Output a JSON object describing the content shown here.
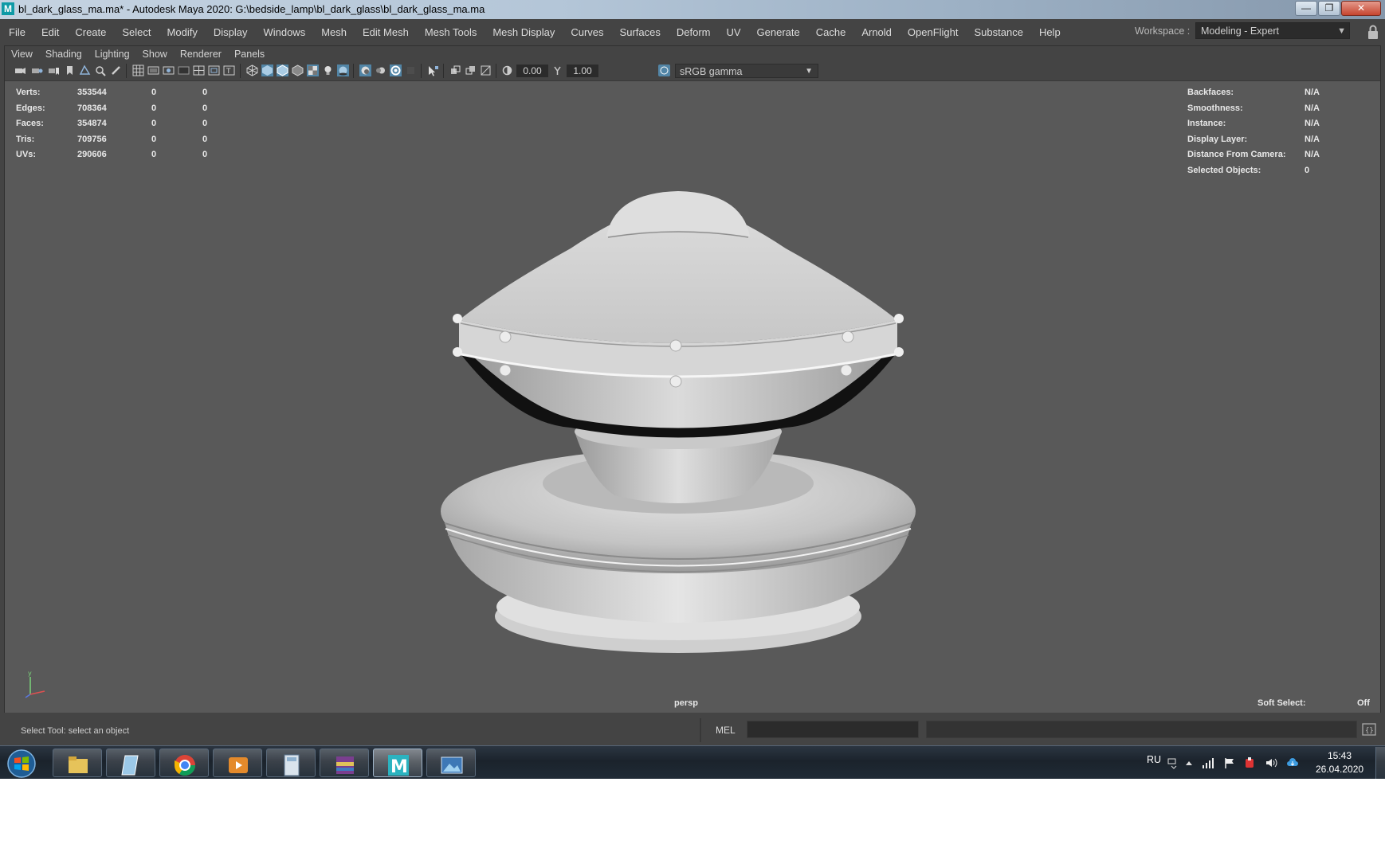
{
  "window": {
    "title": "bl_dark_glass_ma.ma* - Autodesk Maya 2020: G:\\bedside_lamp\\bl_dark_glass\\bl_dark_glass_ma.ma",
    "app_icon": "maya-icon",
    "minimize_glyph": "—",
    "maximize_glyph": "❐",
    "close_glyph": "✕"
  },
  "menubar": {
    "items": [
      "File",
      "Edit",
      "Create",
      "Select",
      "Modify",
      "Display",
      "Windows",
      "Mesh",
      "Edit Mesh",
      "Mesh Tools",
      "Mesh Display",
      "Curves",
      "Surfaces",
      "Deform",
      "UV",
      "Generate",
      "Cache",
      "Arnold",
      "OpenFlight",
      "Substance",
      "Help"
    ],
    "workspace_label": "Workspace :",
    "workspace_value": "Modeling - Expert"
  },
  "panel_menu": {
    "items": [
      "View",
      "Shading",
      "Lighting",
      "Show",
      "Renderer",
      "Panels"
    ]
  },
  "toolbar": {
    "exposure": "0.00",
    "gamma": "1.00",
    "colorspace": "sRGB gamma"
  },
  "hud_left": {
    "rows": [
      {
        "label": "Verts:",
        "total": "353544",
        "sel": "0",
        "comp": "0"
      },
      {
        "label": "Edges:",
        "total": "708364",
        "sel": "0",
        "comp": "0"
      },
      {
        "label": "Faces:",
        "total": "354874",
        "sel": "0",
        "comp": "0"
      },
      {
        "label": "Tris:",
        "total": "709756",
        "sel": "0",
        "comp": "0"
      },
      {
        "label": "UVs:",
        "total": "290606",
        "sel": "0",
        "comp": "0"
      }
    ]
  },
  "hud_right": {
    "rows": [
      {
        "label": "Backfaces:",
        "value": "N/A"
      },
      {
        "label": "Smoothness:",
        "value": "N/A"
      },
      {
        "label": "Instance:",
        "value": "N/A"
      },
      {
        "label": "Display Layer:",
        "value": "N/A"
      },
      {
        "label": "Distance From Camera:",
        "value": "N/A"
      },
      {
        "label": "Selected Objects:",
        "value": "0"
      }
    ]
  },
  "viewport": {
    "camera": "persp",
    "soft_select_label": "Soft Select:",
    "soft_select_value": "Off",
    "axis_y": "y"
  },
  "bottom": {
    "status": "Select Tool: select an object",
    "mel_label": "MEL"
  },
  "taskbar": {
    "apps": [
      "explorer-icon",
      "notepad-icon",
      "chrome-icon",
      "media-player-icon",
      "calculator-icon",
      "winrar-icon",
      "maya-icon",
      "image-viewer-icon"
    ],
    "language": "RU",
    "time": "15:43",
    "date": "26.04.2020"
  }
}
